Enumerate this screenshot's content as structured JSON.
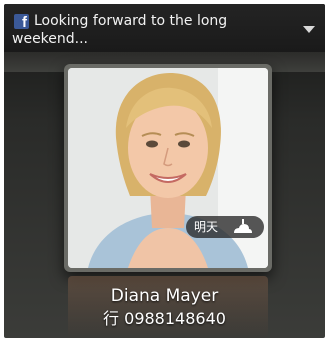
{
  "status_update": {
    "source_icon": "facebook-icon",
    "text": "Looking forward to the long weekend...",
    "dropdown_icon": "chevron-down-icon"
  },
  "contact": {
    "photo_icon": "contact-photo",
    "name": "Diana Mayer",
    "phone": "行 0988148640"
  },
  "weather": {
    "label": "明天",
    "icon": "weather-icon"
  },
  "colors": {
    "facebook_blue": "#3b5998",
    "background": "#2a2b29"
  }
}
